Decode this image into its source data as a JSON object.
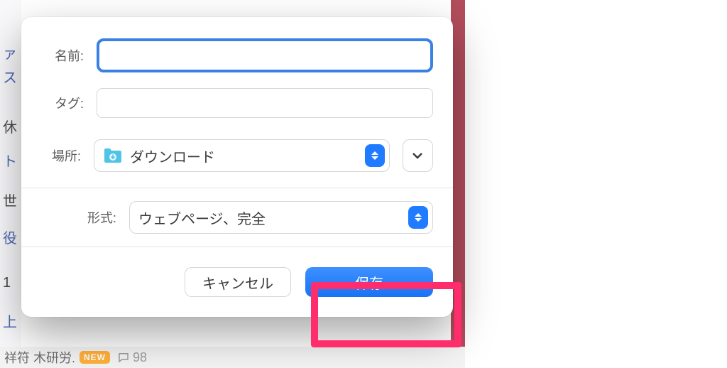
{
  "background": {
    "lines": [
      "ァ",
      "ス",
      "休",
      "ト",
      "世",
      "役",
      "1",
      "上"
    ],
    "bottom_text": "祥符 木研労.",
    "new_badge": "NEW",
    "comment_count": "98"
  },
  "sheet": {
    "labels": {
      "name": "名前:",
      "tags": "タグ:",
      "where": "場所:",
      "format": "形式:"
    },
    "name_value": "",
    "tags_value": "",
    "location": {
      "folder_name": "ダウンロード",
      "icon": "downloads-folder-icon"
    },
    "format_selected": "ウェブページ、完全",
    "buttons": {
      "cancel": "キャンセル",
      "save": "保存"
    }
  }
}
